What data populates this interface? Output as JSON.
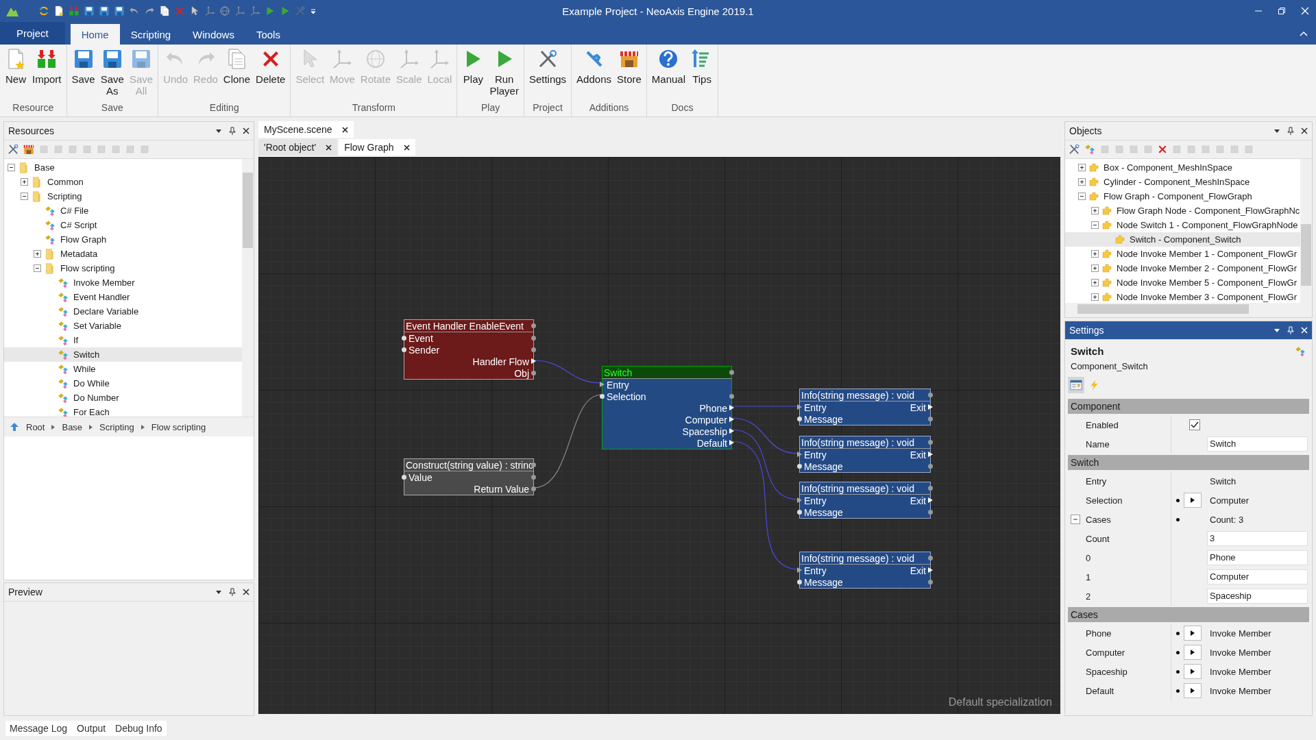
{
  "window": {
    "title": "Example Project - NeoAxis Engine 2019.1"
  },
  "menu_tabs": [
    {
      "label": "Project",
      "kind": "app_menu",
      "selected": false
    },
    {
      "label": "Home",
      "kind": "tab",
      "selected": true
    },
    {
      "label": "Scripting",
      "kind": "tab",
      "selected": false
    },
    {
      "label": "Windows",
      "kind": "tab",
      "selected": false
    },
    {
      "label": "Tools",
      "kind": "tab",
      "selected": false
    }
  ],
  "ribbon": [
    {
      "label": "Resource",
      "buttons": [
        {
          "label": "New",
          "disabled": false
        },
        {
          "label": "Import",
          "disabled": false
        }
      ]
    },
    {
      "label": "Save",
      "buttons": [
        {
          "label": "Save",
          "disabled": false
        },
        {
          "label": "Save As",
          "disabled": false
        },
        {
          "label": "Save All",
          "disabled": true
        }
      ]
    },
    {
      "label": "Editing",
      "buttons": [
        {
          "label": "Undo",
          "disabled": true
        },
        {
          "label": "Redo",
          "disabled": true
        },
        {
          "label": "Clone",
          "disabled": false
        },
        {
          "label": "Delete",
          "disabled": false
        }
      ]
    },
    {
      "label": "Transform",
      "buttons": [
        {
          "label": "Select",
          "disabled": true
        },
        {
          "label": "Move",
          "disabled": true
        },
        {
          "label": "Rotate",
          "disabled": true
        },
        {
          "label": "Scale",
          "disabled": true
        },
        {
          "label": "Local",
          "disabled": true
        }
      ]
    },
    {
      "label": "Play",
      "buttons": [
        {
          "label": "Play",
          "disabled": false
        },
        {
          "label": "Run Player",
          "disabled": false
        }
      ]
    },
    {
      "label": "Project",
      "buttons": [
        {
          "label": "Settings",
          "disabled": false
        }
      ]
    },
    {
      "label": "Additions",
      "buttons": [
        {
          "label": "Addons",
          "disabled": false
        },
        {
          "label": "Store",
          "disabled": false
        }
      ]
    },
    {
      "label": "Docs",
      "buttons": [
        {
          "label": "Manual",
          "disabled": false
        },
        {
          "label": "Tips",
          "disabled": false
        }
      ]
    }
  ],
  "resources": {
    "title": "Resources",
    "tree": [
      {
        "label": "Base",
        "kind": "folder",
        "expanded": true,
        "selected": false,
        "children": [
          {
            "label": "Common",
            "kind": "folder",
            "expanded": false,
            "selected": false
          },
          {
            "label": "Scripting",
            "kind": "folder",
            "expanded": true,
            "selected": false,
            "children": [
              {
                "label": "C# File",
                "kind": "resource",
                "selected": false
              },
              {
                "label": "C# Script",
                "kind": "resource",
                "selected": false
              },
              {
                "label": "Flow Graph",
                "kind": "resource",
                "selected": false
              },
              {
                "label": "Metadata",
                "kind": "folder",
                "expanded": false,
                "selected": false
              },
              {
                "label": "Flow scripting",
                "kind": "folder",
                "expanded": true,
                "selected": false,
                "children": [
                  {
                    "label": "Invoke Member",
                    "kind": "resource",
                    "selected": false
                  },
                  {
                    "label": "Event Handler",
                    "kind": "resource",
                    "selected": false
                  },
                  {
                    "label": "Declare Variable",
                    "kind": "resource",
                    "selected": false
                  },
                  {
                    "label": "Set Variable",
                    "kind": "resource",
                    "selected": false
                  },
                  {
                    "label": "If",
                    "kind": "resource",
                    "selected": false
                  },
                  {
                    "label": "Switch",
                    "kind": "resource",
                    "selected": true
                  },
                  {
                    "label": "While",
                    "kind": "resource",
                    "selected": false
                  },
                  {
                    "label": "Do While",
                    "kind": "resource",
                    "selected": false
                  },
                  {
                    "label": "Do Number",
                    "kind": "resource",
                    "selected": false
                  },
                  {
                    "label": "For Each",
                    "kind": "resource",
                    "selected": false
                  }
                ]
              }
            ]
          }
        ]
      }
    ],
    "breadcrumb": [
      "Root",
      "Base",
      "Scripting",
      "Flow scripting"
    ]
  },
  "preview": {
    "title": "Preview"
  },
  "document_tabs": [
    {
      "label": "MyScene.scene",
      "selected": true
    }
  ],
  "sub_tabs": [
    {
      "label": "'Root object'",
      "selected": false
    },
    {
      "label": "Flow Graph",
      "selected": true
    }
  ],
  "graph": {
    "nodes": [
      {
        "title": "Event Handler EnableEvent",
        "kind": "event",
        "rows": [
          {
            "left": "Event",
            "kind": "data"
          },
          {
            "left": "Sender",
            "kind": "data"
          },
          {
            "right": "Handler Flow",
            "kind": "flow"
          },
          {
            "right": "Obj",
            "kind": "data"
          }
        ]
      },
      {
        "title": "Switch",
        "kind": "switch",
        "rows": [
          {
            "left": "Entry",
            "kind": "flow"
          },
          {
            "left": "Selection",
            "kind": "data"
          },
          {
            "right": "Phone",
            "kind": "flow"
          },
          {
            "right": "Computer",
            "kind": "flow"
          },
          {
            "right": "Spaceship",
            "kind": "flow"
          },
          {
            "right": "Default",
            "kind": "flow"
          }
        ]
      },
      {
        "title": "Construct(string value) : strinc",
        "kind": "construct",
        "rows": [
          {
            "left": "Value",
            "kind": "data"
          },
          {
            "right": "Return Value",
            "kind": "data"
          }
        ]
      },
      {
        "title": "Info(string message) : void",
        "kind": "method",
        "rows": [
          {
            "left": "Entry",
            "right": "Exit",
            "kind": "flow"
          },
          {
            "left": "Message",
            "kind": "data"
          }
        ]
      },
      {
        "title": "Info(string message) : void",
        "kind": "method",
        "rows": [
          {
            "left": "Entry",
            "right": "Exit",
            "kind": "flow"
          },
          {
            "left": "Message",
            "kind": "data"
          }
        ]
      },
      {
        "title": "Info(string message) : void",
        "kind": "method",
        "rows": [
          {
            "left": "Entry",
            "right": "Exit",
            "kind": "flow"
          },
          {
            "left": "Message",
            "kind": "data"
          }
        ]
      },
      {
        "title": "Info(string message) : void",
        "kind": "method",
        "rows": [
          {
            "left": "Entry",
            "right": "Exit",
            "kind": "flow"
          },
          {
            "left": "Message",
            "kind": "data"
          }
        ]
      }
    ],
    "caption": "Default specialization"
  },
  "objects": {
    "title": "Objects",
    "tree": [
      {
        "label": "Box - Component_MeshInSpace",
        "expanded": false,
        "selected": false
      },
      {
        "label": "Cylinder - Component_MeshInSpace",
        "expanded": false,
        "selected": false
      },
      {
        "label": "Flow Graph - Component_FlowGraph",
        "expanded": true,
        "selected": false,
        "children": [
          {
            "label": "Flow Graph Node - Component_FlowGraphNc",
            "expanded": false,
            "selected": false
          },
          {
            "label": "Node Switch 1 - Component_FlowGraphNode",
            "expanded": true,
            "selected": false,
            "children": [
              {
                "label": "Switch - Component_Switch",
                "selected": true
              }
            ]
          },
          {
            "label": "Node Invoke Member 1 - Component_FlowGr",
            "expanded": false,
            "selected": false
          },
          {
            "label": "Node Invoke Member 2 - Component_FlowGr",
            "expanded": false,
            "selected": false
          },
          {
            "label": "Node Invoke Member 5 - Component_FlowGr",
            "expanded": false,
            "selected": false
          },
          {
            "label": "Node Invoke Member 3 - Component_FlowGr",
            "expanded": false,
            "selected": false
          }
        ]
      }
    ]
  },
  "settings": {
    "title": "Settings",
    "object_name": "Switch",
    "object_type": "Component_Switch",
    "categories": [
      {
        "label": "Component",
        "properties": [
          {
            "label": "Enabled",
            "kind": "checkbox",
            "checked": true
          },
          {
            "label": "Name",
            "kind": "field",
            "value": "Switch"
          }
        ]
      },
      {
        "label": "Switch",
        "properties": [
          {
            "label": "Entry",
            "kind": "text",
            "value": "Switch"
          },
          {
            "label": "Selection",
            "kind": "reference",
            "value": "Computer"
          },
          {
            "label": "Cases",
            "kind": "list",
            "expanded": true,
            "value": "Count: 3",
            "children": [
              {
                "label": "Count",
                "kind": "field",
                "value": "3"
              },
              {
                "label": "0",
                "kind": "field",
                "value": "Phone"
              },
              {
                "label": "1",
                "kind": "field",
                "value": "Computer"
              },
              {
                "label": "2",
                "kind": "field",
                "value": "Spaceship"
              }
            ]
          }
        ]
      },
      {
        "label": "Cases",
        "properties": [
          {
            "label": "Phone",
            "kind": "reference",
            "value": "Invoke Member"
          },
          {
            "label": "Computer",
            "kind": "reference",
            "value": "Invoke Member"
          },
          {
            "label": "Spaceship",
            "kind": "reference",
            "value": "Invoke Member"
          },
          {
            "label": "Default",
            "kind": "reference",
            "value": "Invoke Member"
          }
        ]
      }
    ]
  },
  "bottom_tabs": [
    "Message Log",
    "Output",
    "Debug Info"
  ]
}
